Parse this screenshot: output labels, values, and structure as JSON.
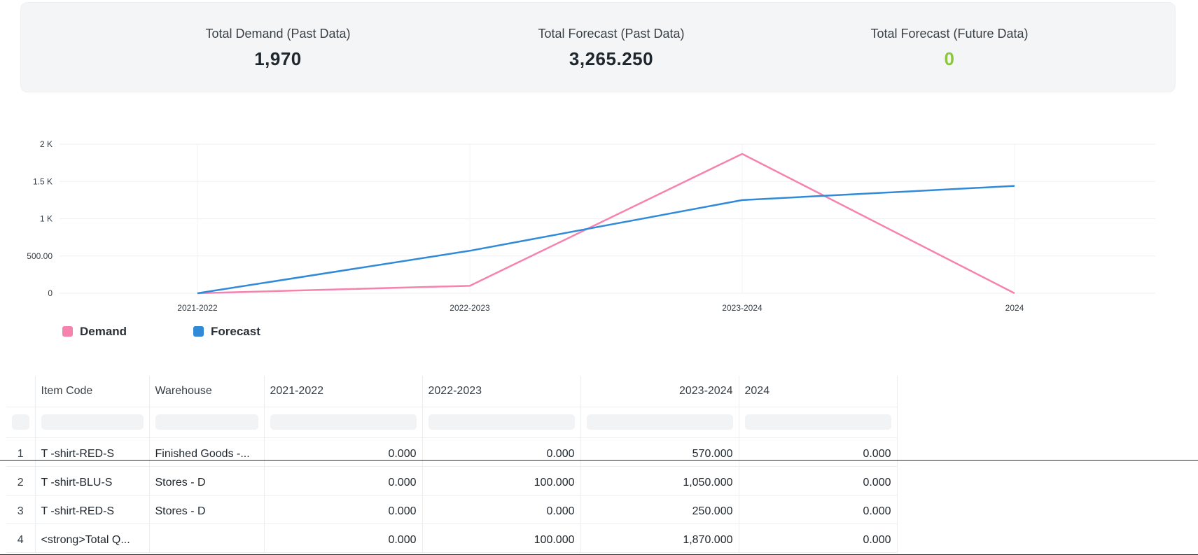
{
  "summary": {
    "cards": [
      {
        "label": "Total Demand (Past Data)",
        "value": "1,970"
      },
      {
        "label": "Total Forecast (Past Data)",
        "value": "3,265.250"
      },
      {
        "label": "Total Forecast (Future Data)",
        "value": "0"
      }
    ],
    "colors": {
      "future_value": "#8cc63f"
    }
  },
  "chart_data": {
    "type": "line",
    "categories": [
      "2021-2022",
      "2022-2023",
      "2023-2024",
      "2024"
    ],
    "ylim": [
      0,
      2000
    ],
    "ytick_values": [
      0,
      500,
      1000,
      1500,
      2000
    ],
    "ytick_labels": [
      "0",
      "500.00",
      "1 K",
      "1.5 K",
      "2 K"
    ],
    "grid": true,
    "legend_position": "bottom-left",
    "series": [
      {
        "name": "Demand",
        "color": "#f683ae",
        "values": [
          0,
          100,
          1870,
          0
        ]
      },
      {
        "name": "Forecast",
        "color": "#318ad8",
        "values": [
          0,
          570,
          1250,
          1440
        ]
      }
    ]
  },
  "table": {
    "columns": [
      "",
      "Item Code",
      "Warehouse",
      "2021-2022",
      "2022-2023",
      "2023-2024",
      "2024"
    ],
    "rows": [
      {
        "idx": "1",
        "item_code": "T -shirt-RED-S",
        "warehouse": "Finished Goods -...",
        "y1": "0.000",
        "y2": "0.000",
        "y3": "570.000",
        "y4": "0.000"
      },
      {
        "idx": "2",
        "item_code": "T -shirt-BLU-S",
        "warehouse": "Stores - D",
        "y1": "0.000",
        "y2": "100.000",
        "y3": "1,050.000",
        "y4": "0.000"
      },
      {
        "idx": "3",
        "item_code": "T -shirt-RED-S",
        "warehouse": "Stores - D",
        "y1": "0.000",
        "y2": "0.000",
        "y3": "250.000",
        "y4": "0.000"
      },
      {
        "idx": "4",
        "item_code": "<strong>Total Q...",
        "warehouse": "",
        "y1": "0.000",
        "y2": "100.000",
        "y3": "1,870.000",
        "y4": "0.000"
      }
    ]
  }
}
